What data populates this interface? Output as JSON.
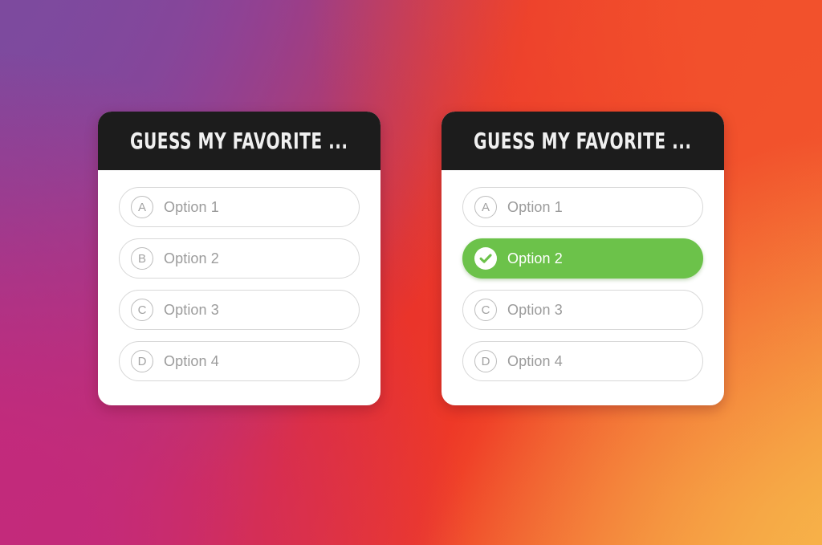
{
  "background": {
    "gradient_colors": [
      "#7d4a9e",
      "#c32a7b",
      "#ee2b24",
      "#f2512c",
      "#f6a83f"
    ],
    "style_name": "instagram-gradient"
  },
  "theme": {
    "header_background": "#1c1c1c",
    "header_text_color": "#f0f0f0",
    "card_background": "#ffffff",
    "option_border_color": "#d8d8d8",
    "option_text_color": "#9b9b9b",
    "selected_color": "#6cc24a",
    "selected_text_color": "#ffffff"
  },
  "cards": [
    {
      "id": "unanswered",
      "title": "GUESS MY FAVORITE ...",
      "options": [
        {
          "letter": "A",
          "label": "Option 1",
          "selected": false
        },
        {
          "letter": "B",
          "label": "Option 2",
          "selected": false
        },
        {
          "letter": "C",
          "label": "Option 3",
          "selected": false
        },
        {
          "letter": "D",
          "label": "Option 4",
          "selected": false
        }
      ]
    },
    {
      "id": "answered",
      "title": "GUESS MY FAVORITE ...",
      "options": [
        {
          "letter": "A",
          "label": "Option 1",
          "selected": false
        },
        {
          "letter": "",
          "label": "Option 2",
          "selected": true,
          "icon": "check-icon"
        },
        {
          "letter": "C",
          "label": "Option 3",
          "selected": false
        },
        {
          "letter": "D",
          "label": "Option 4",
          "selected": false
        }
      ]
    }
  ]
}
